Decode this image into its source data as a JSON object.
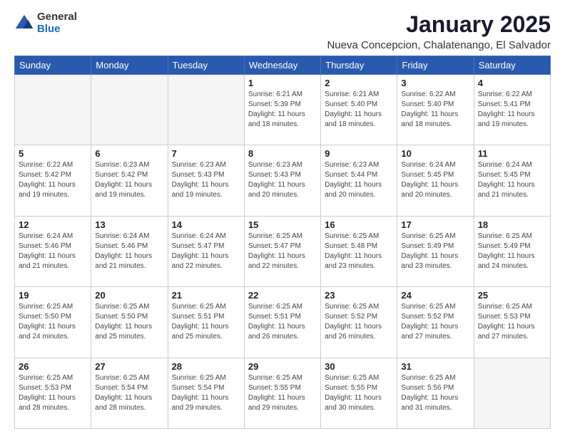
{
  "logo": {
    "general": "General",
    "blue": "Blue"
  },
  "title": "January 2025",
  "location": "Nueva Concepcion, Chalatenango, El Salvador",
  "weekdays": [
    "Sunday",
    "Monday",
    "Tuesday",
    "Wednesday",
    "Thursday",
    "Friday",
    "Saturday"
  ],
  "weeks": [
    [
      {
        "day": "",
        "info": ""
      },
      {
        "day": "",
        "info": ""
      },
      {
        "day": "",
        "info": ""
      },
      {
        "day": "1",
        "info": "Sunrise: 6:21 AM\nSunset: 5:39 PM\nDaylight: 11 hours\nand 18 minutes."
      },
      {
        "day": "2",
        "info": "Sunrise: 6:21 AM\nSunset: 5:40 PM\nDaylight: 11 hours\nand 18 minutes."
      },
      {
        "day": "3",
        "info": "Sunrise: 6:22 AM\nSunset: 5:40 PM\nDaylight: 11 hours\nand 18 minutes."
      },
      {
        "day": "4",
        "info": "Sunrise: 6:22 AM\nSunset: 5:41 PM\nDaylight: 11 hours\nand 19 minutes."
      }
    ],
    [
      {
        "day": "5",
        "info": "Sunrise: 6:22 AM\nSunset: 5:42 PM\nDaylight: 11 hours\nand 19 minutes."
      },
      {
        "day": "6",
        "info": "Sunrise: 6:23 AM\nSunset: 5:42 PM\nDaylight: 11 hours\nand 19 minutes."
      },
      {
        "day": "7",
        "info": "Sunrise: 6:23 AM\nSunset: 5:43 PM\nDaylight: 11 hours\nand 19 minutes."
      },
      {
        "day": "8",
        "info": "Sunrise: 6:23 AM\nSunset: 5:43 PM\nDaylight: 11 hours\nand 20 minutes."
      },
      {
        "day": "9",
        "info": "Sunrise: 6:23 AM\nSunset: 5:44 PM\nDaylight: 11 hours\nand 20 minutes."
      },
      {
        "day": "10",
        "info": "Sunrise: 6:24 AM\nSunset: 5:45 PM\nDaylight: 11 hours\nand 20 minutes."
      },
      {
        "day": "11",
        "info": "Sunrise: 6:24 AM\nSunset: 5:45 PM\nDaylight: 11 hours\nand 21 minutes."
      }
    ],
    [
      {
        "day": "12",
        "info": "Sunrise: 6:24 AM\nSunset: 5:46 PM\nDaylight: 11 hours\nand 21 minutes."
      },
      {
        "day": "13",
        "info": "Sunrise: 6:24 AM\nSunset: 5:46 PM\nDaylight: 11 hours\nand 21 minutes."
      },
      {
        "day": "14",
        "info": "Sunrise: 6:24 AM\nSunset: 5:47 PM\nDaylight: 11 hours\nand 22 minutes."
      },
      {
        "day": "15",
        "info": "Sunrise: 6:25 AM\nSunset: 5:47 PM\nDaylight: 11 hours\nand 22 minutes."
      },
      {
        "day": "16",
        "info": "Sunrise: 6:25 AM\nSunset: 5:48 PM\nDaylight: 11 hours\nand 23 minutes."
      },
      {
        "day": "17",
        "info": "Sunrise: 6:25 AM\nSunset: 5:49 PM\nDaylight: 11 hours\nand 23 minutes."
      },
      {
        "day": "18",
        "info": "Sunrise: 6:25 AM\nSunset: 5:49 PM\nDaylight: 11 hours\nand 24 minutes."
      }
    ],
    [
      {
        "day": "19",
        "info": "Sunrise: 6:25 AM\nSunset: 5:50 PM\nDaylight: 11 hours\nand 24 minutes."
      },
      {
        "day": "20",
        "info": "Sunrise: 6:25 AM\nSunset: 5:50 PM\nDaylight: 11 hours\nand 25 minutes."
      },
      {
        "day": "21",
        "info": "Sunrise: 6:25 AM\nSunset: 5:51 PM\nDaylight: 11 hours\nand 25 minutes."
      },
      {
        "day": "22",
        "info": "Sunrise: 6:25 AM\nSunset: 5:51 PM\nDaylight: 11 hours\nand 26 minutes."
      },
      {
        "day": "23",
        "info": "Sunrise: 6:25 AM\nSunset: 5:52 PM\nDaylight: 11 hours\nand 26 minutes."
      },
      {
        "day": "24",
        "info": "Sunrise: 6:25 AM\nSunset: 5:52 PM\nDaylight: 11 hours\nand 27 minutes."
      },
      {
        "day": "25",
        "info": "Sunrise: 6:25 AM\nSunset: 5:53 PM\nDaylight: 11 hours\nand 27 minutes."
      }
    ],
    [
      {
        "day": "26",
        "info": "Sunrise: 6:25 AM\nSunset: 5:53 PM\nDaylight: 11 hours\nand 28 minutes."
      },
      {
        "day": "27",
        "info": "Sunrise: 6:25 AM\nSunset: 5:54 PM\nDaylight: 11 hours\nand 28 minutes."
      },
      {
        "day": "28",
        "info": "Sunrise: 6:25 AM\nSunset: 5:54 PM\nDaylight: 11 hours\nand 29 minutes."
      },
      {
        "day": "29",
        "info": "Sunrise: 6:25 AM\nSunset: 5:55 PM\nDaylight: 11 hours\nand 29 minutes."
      },
      {
        "day": "30",
        "info": "Sunrise: 6:25 AM\nSunset: 5:55 PM\nDaylight: 11 hours\nand 30 minutes."
      },
      {
        "day": "31",
        "info": "Sunrise: 6:25 AM\nSunset: 5:56 PM\nDaylight: 11 hours\nand 31 minutes."
      },
      {
        "day": "",
        "info": ""
      }
    ]
  ]
}
